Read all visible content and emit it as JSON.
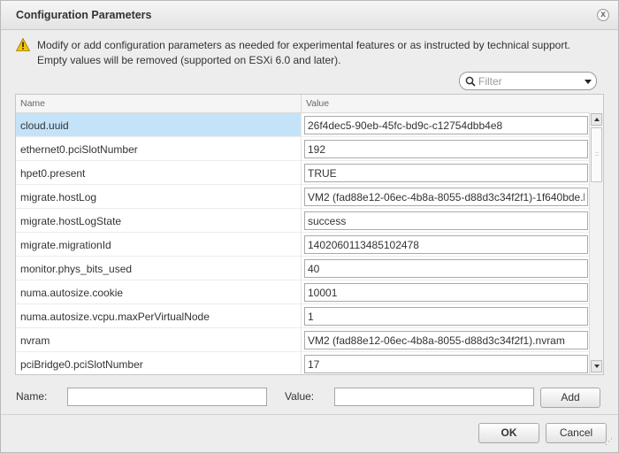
{
  "dialog": {
    "title": "Configuration Parameters",
    "close_label": "x"
  },
  "info": {
    "icon": "warning-icon",
    "line1": "Modify or add configuration parameters as needed for experimental features or as instructed by technical support.",
    "line2": "Empty values will be removed (supported on ESXi 6.0 and later)."
  },
  "filter": {
    "placeholder": "Filter",
    "icon": "search-icon"
  },
  "table": {
    "columns": [
      "Name",
      "Value"
    ],
    "selected_row": 0,
    "rows": [
      {
        "name": "cloud.uuid",
        "value": "26f4dec5-90eb-45fc-bd9c-c12754dbb4e8"
      },
      {
        "name": "ethernet0.pciSlotNumber",
        "value": "192"
      },
      {
        "name": "hpet0.present",
        "value": "TRUE"
      },
      {
        "name": "migrate.hostLog",
        "value": "VM2 (fad88e12-06ec-4b8a-8055-d88d3c34f2f1)-1f640bde.h"
      },
      {
        "name": "migrate.hostLogState",
        "value": "success"
      },
      {
        "name": "migrate.migrationId",
        "value": "1402060113485102478"
      },
      {
        "name": "monitor.phys_bits_used",
        "value": "40"
      },
      {
        "name": "numa.autosize.cookie",
        "value": "10001"
      },
      {
        "name": "numa.autosize.vcpu.maxPerVirtualNode",
        "value": "1"
      },
      {
        "name": "nvram",
        "value": "VM2 (fad88e12-06ec-4b8a-8055-d88d3c34f2f1).nvram"
      },
      {
        "name": "pciBridge0.pciSlotNumber",
        "value": "17"
      }
    ]
  },
  "add_form": {
    "name_label": "Name:",
    "value_label": "Value:",
    "name_value": "",
    "value_value": "",
    "add_button": "Add"
  },
  "footer": {
    "ok_label": "OK",
    "cancel_label": "Cancel"
  },
  "colors": {
    "selected_row": "#c4e3f8",
    "warning": "#f5c400"
  }
}
